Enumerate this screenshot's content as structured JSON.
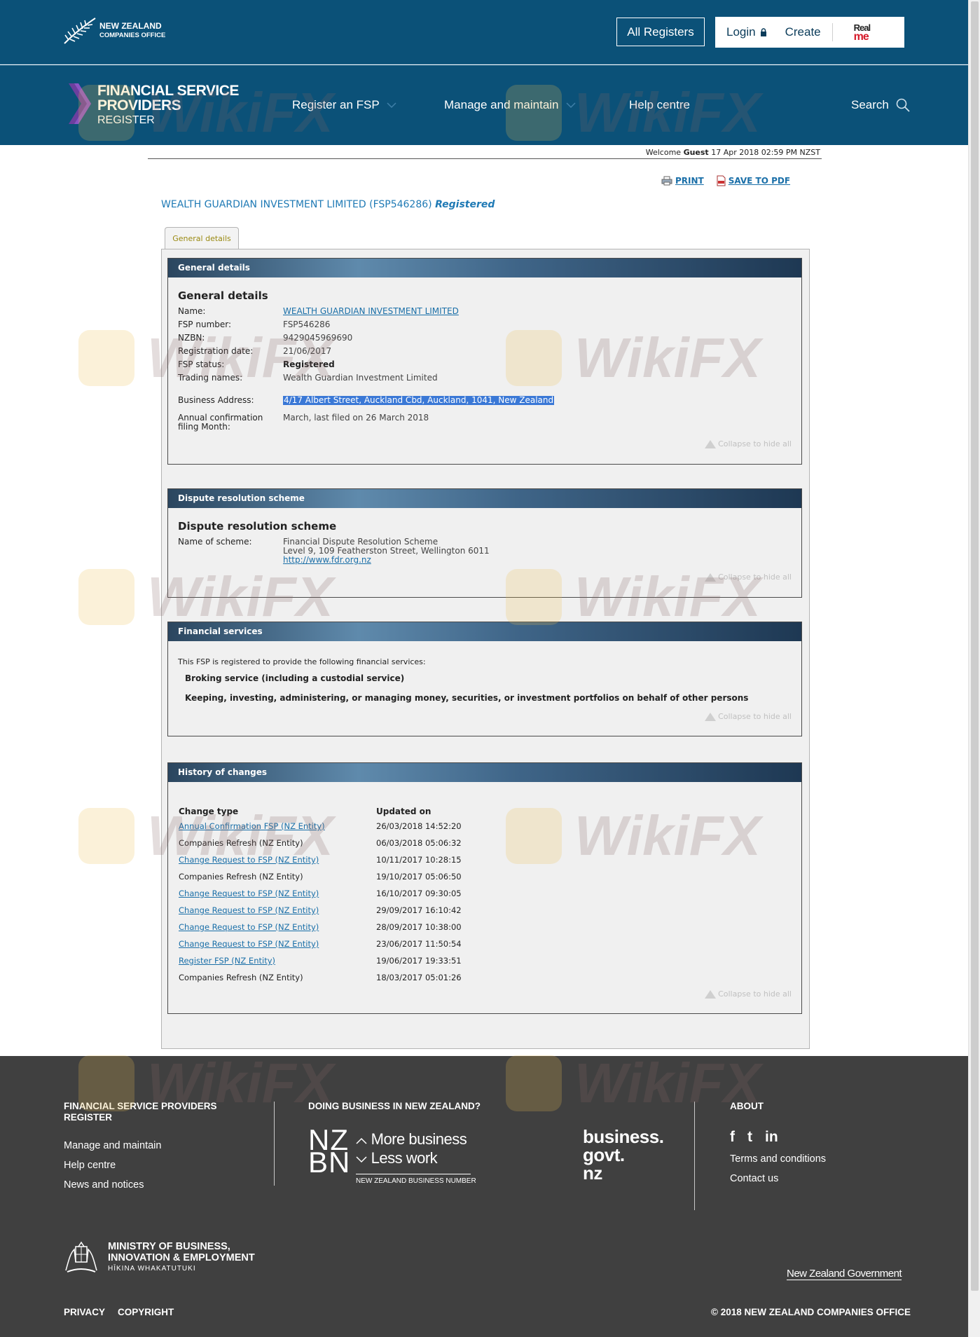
{
  "topbar": {
    "logo_line1": "NEW ZEALAND",
    "logo_line2": "COMPANIES OFFICE",
    "all_registers": "All Registers",
    "login": "Login",
    "create": "Create",
    "realme_1": "Real",
    "realme_2": "me"
  },
  "nav": {
    "brand_line1": "FINANCIAL SERVICE",
    "brand_line2": "PROVIDERS",
    "brand_line3": "REGISTER",
    "items": [
      {
        "label": "Register an FSP"
      },
      {
        "label": "Manage and maintain"
      },
      {
        "label": "Help centre"
      }
    ],
    "search": "Search"
  },
  "welcome": {
    "prefix": "Welcome",
    "user": "Guest",
    "datetime": "17 Apr 2018 02:59 PM NZST"
  },
  "tools": {
    "print": "PRINT",
    "save_pdf": "SAVE TO PDF"
  },
  "title": {
    "entity": "WEALTH GUARDIAN INVESTMENT LIMITED (FSP546286)",
    "status": "Registered"
  },
  "tab": "General details",
  "general": {
    "header": "General details",
    "heading": "General details",
    "rows": [
      {
        "k": "Name:",
        "v": "WEALTH GUARDIAN INVESTMENT LIMITED"
      },
      {
        "k": "FSP number:",
        "v": "FSP546286"
      },
      {
        "k": "NZBN:",
        "v": "9429045969690"
      },
      {
        "k": "Registration date:",
        "v": "21/06/2017"
      },
      {
        "k": "FSP status:",
        "v": "Registered"
      },
      {
        "k": "Trading names:",
        "v": "Wealth Guardian Investment Limited"
      },
      {
        "k": "Business Address:",
        "v": "4/17 Albert Street, Auckland Cbd, Auckland, 1041, New Zealand"
      },
      {
        "k1": "Annual confirmation",
        "k2": "filing Month:",
        "v": "March, last filed on 26 March 2018"
      }
    ],
    "collapse": "Collapse to hide all"
  },
  "dispute": {
    "header": "Dispute resolution scheme",
    "heading": "Dispute resolution scheme",
    "label": "Name of scheme:",
    "line1": "Financial Dispute Resolution Scheme",
    "line2": "Level 9, 109 Featherston Street, Wellington 6011",
    "url": "http://www.fdr.org.nz",
    "collapse": "Collapse to hide all"
  },
  "services": {
    "header": "Financial services",
    "intro": "This FSP is registered to provide the following financial services:",
    "items": [
      "Broking service (including a custodial service)",
      "Keeping, investing, administering, or managing money, securities, or investment portfolios on behalf of other persons"
    ],
    "collapse": "Collapse to hide all"
  },
  "history": {
    "header": "History of changes",
    "col1": "Change type",
    "col2": "Updated on",
    "rows": [
      {
        "type": "Annual Confirmation FSP (NZ Entity)",
        "date": "26/03/2018 14:52:20"
      },
      {
        "type": "Companies Refresh (NZ Entity)",
        "date": "06/03/2018 05:06:32"
      },
      {
        "type": "Change Request to FSP (NZ Entity)",
        "date": "10/11/2017 10:28:15"
      },
      {
        "type": "Companies Refresh (NZ Entity)",
        "date": "19/10/2017 05:06:50"
      },
      {
        "type": "Change Request to FSP (NZ Entity)",
        "date": "16/10/2017 09:30:05"
      },
      {
        "type": "Change Request to FSP (NZ Entity)",
        "date": "29/09/2017 16:10:42"
      },
      {
        "type": "Change Request to FSP (NZ Entity)",
        "date": "28/09/2017 10:38:00"
      },
      {
        "type": "Change Request to FSP (NZ Entity)",
        "date": "23/06/2017 11:50:54"
      },
      {
        "type": "Register FSP (NZ Entity)",
        "date": "19/06/2017 19:33:51"
      },
      {
        "type": "Companies Refresh (NZ Entity)",
        "date": "18/03/2017 05:01:26"
      }
    ],
    "collapse": "Collapse to hide all"
  },
  "footer": {
    "col1_head_1": "FINANCIAL SERVICE PROVIDERS",
    "col1_head_2": "REGISTER",
    "col1_links": [
      "Manage and maintain",
      "Help centre",
      "News and notices"
    ],
    "col2_head": "DOING BUSINESS IN NEW ZEALAND?",
    "nzbn_nz": "NZ",
    "nzbn_bn": "BN",
    "nzbn_tag1": "More business",
    "nzbn_tag2": "Less work",
    "nzbn_small": "NEW ZEALAND BUSINESS NUMBER",
    "bgn_1": "business.",
    "bgn_2": "govt.",
    "bgn_3": "nz",
    "about_head": "ABOUT",
    "social": [
      "f",
      "t",
      "in"
    ],
    "about_links": [
      "Terms and conditions",
      "Contact us"
    ],
    "mbie_1": "MINISTRY OF BUSINESS,",
    "mbie_2": "INNOVATION & EMPLOYMENT",
    "mbie_3": "HĪKINA WHAKATUTUKI",
    "nzgov": "New Zealand Government",
    "privacy": "PRIVACY",
    "copyright": "COPYRIGHT",
    "copy_notice": "© 2018 NEW ZEALAND COMPANIES OFFICE"
  },
  "watermark": "WikiFX",
  "colors": {
    "header_bg": "#0b5178",
    "footer_bg": "#404040",
    "link": "#1a6fa8"
  }
}
